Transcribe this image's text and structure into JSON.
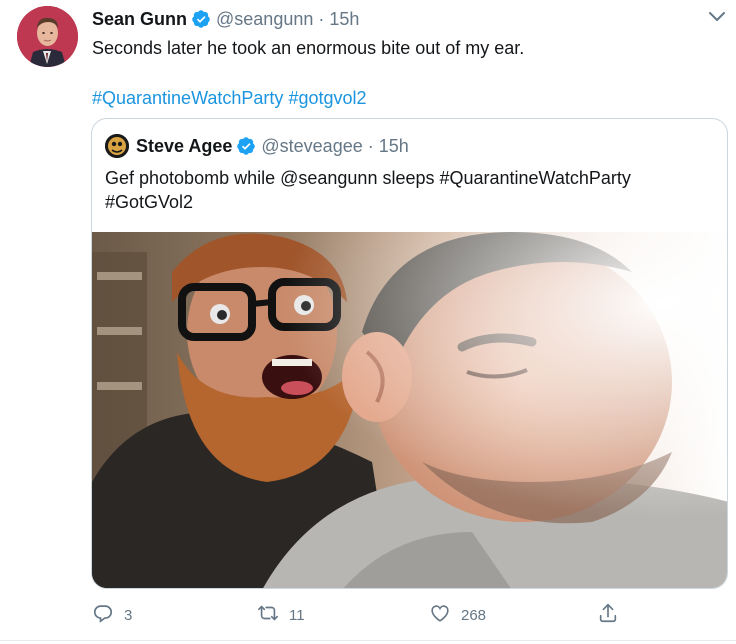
{
  "tweet": {
    "author_name": "Sean Gunn",
    "handle": "@seangunn",
    "separator": "·",
    "time": "15h",
    "text": "Seconds later he took an enormous bite out of my ear.",
    "hashtags": [
      "#QuarantineWatchParty",
      "#gotgvol2"
    ]
  },
  "quote": {
    "author_name": "Steve Agee",
    "handle": "@steveagee",
    "separator": "·",
    "time": "15h",
    "text_line1": "Gef photobomb while @seangunn  sleeps #QuarantineWatchParty",
    "text_line2": "#GotGVol2"
  },
  "actions": {
    "reply_count": "3",
    "retweet_count": "11",
    "like_count": "268"
  },
  "icons": {
    "verified": "verified-badge-icon",
    "caret": "chevron-down-icon",
    "reply": "reply-icon",
    "retweet": "retweet-icon",
    "like": "heart-icon",
    "share": "share-icon"
  },
  "colors": {
    "link": "#1b95e0",
    "verified": "#1da1f2",
    "muted": "#657786",
    "border": "#ccd6dd"
  }
}
